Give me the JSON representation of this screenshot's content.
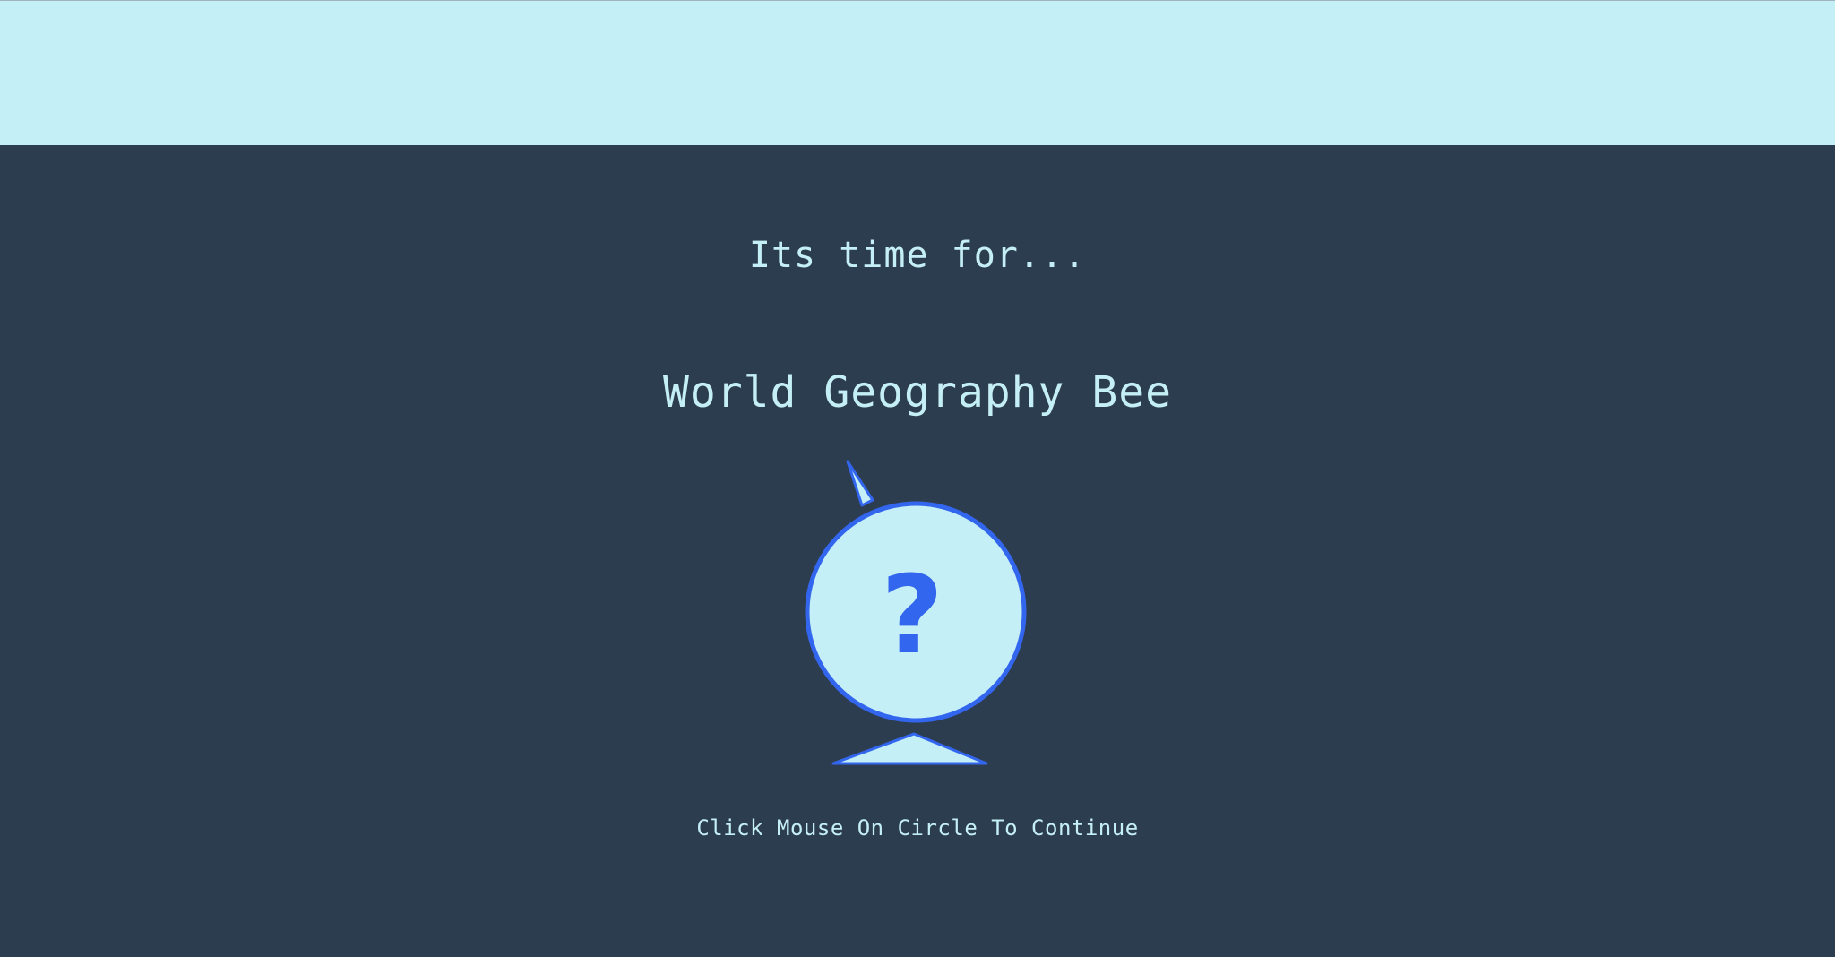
{
  "colors": {
    "top_band": "#c5eff6",
    "background": "#2d3d50",
    "text": "#c5eff6",
    "accent_blue": "#3366ee",
    "globe_fill": "#c5eff6"
  },
  "intro": {
    "text": "Its time for..."
  },
  "title": {
    "text": "World Geography Bee"
  },
  "globe": {
    "symbol": "?",
    "icon": "globe-question-icon"
  },
  "instruction": {
    "text": "Click Mouse On Circle To Continue"
  }
}
